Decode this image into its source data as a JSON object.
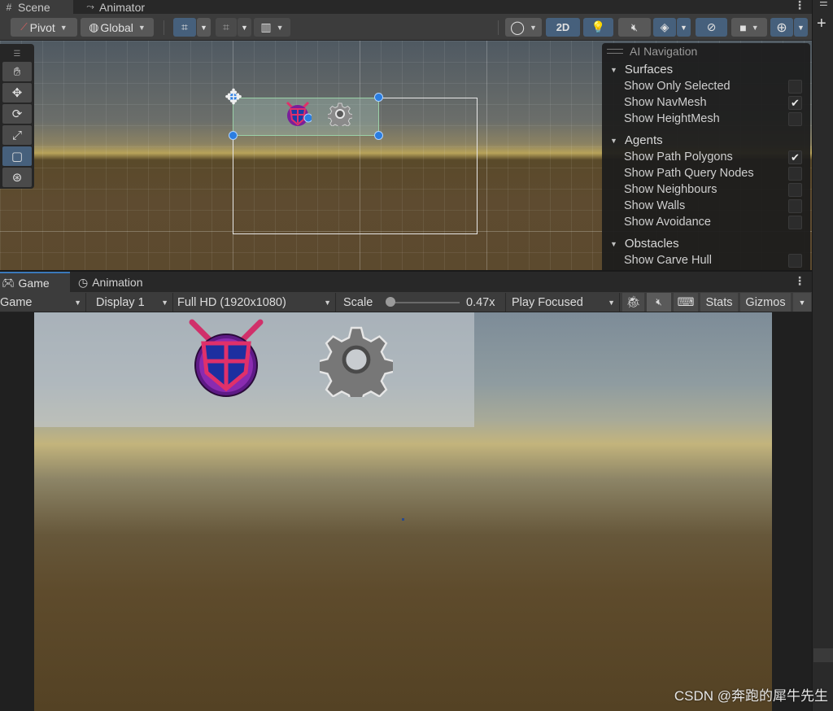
{
  "scene_panel": {
    "tabs": [
      {
        "label": "Scene",
        "icon": "grid-icon"
      },
      {
        "label": "Animator",
        "icon": "animator-icon"
      }
    ],
    "toolbar": {
      "pivot_label": "Pivot",
      "global_label": "Global",
      "twod_label": "2D"
    },
    "tools": [
      "hand-tool",
      "move-tool",
      "rotate-tool",
      "scale-tool",
      "rect-tool",
      "transform-tool"
    ],
    "active_tool": "rect-tool"
  },
  "ai_navigation": {
    "title": "AI Navigation",
    "sections": [
      {
        "label": "Surfaces",
        "items": [
          {
            "label": "Show Only Selected",
            "checked": false
          },
          {
            "label": "Show NavMesh",
            "checked": true
          },
          {
            "label": "Show HeightMesh",
            "checked": false
          }
        ]
      },
      {
        "label": "Agents",
        "items": [
          {
            "label": "Show Path Polygons",
            "checked": true
          },
          {
            "label": "Show Path Query Nodes",
            "checked": false
          },
          {
            "label": "Show Neighbours",
            "checked": false
          },
          {
            "label": "Show Walls",
            "checked": false
          },
          {
            "label": "Show Avoidance",
            "checked": false
          }
        ]
      },
      {
        "label": "Obstacles",
        "items": [
          {
            "label": "Show Carve Hull",
            "checked": false
          }
        ]
      }
    ]
  },
  "game_panel": {
    "tabs": [
      {
        "label": "Game",
        "icon": "gamepad-icon"
      },
      {
        "label": "Animation",
        "icon": "clock-icon"
      }
    ],
    "toolbar": {
      "view_mode": "Game",
      "display": "Display 1",
      "resolution": "Full HD (1920x1080)",
      "scale_label": "Scale",
      "scale_value": "0.47x",
      "scale_fraction": 0.05,
      "play_mode": "Play Focused",
      "stats_label": "Stats",
      "gizmos_label": "Gizmos"
    }
  },
  "watermark": "CSDN @奔跑的犀牛先生",
  "colors": {
    "accent": "#46607c",
    "handle": "#2a7de1",
    "tab_underline": "#3a79bb"
  }
}
